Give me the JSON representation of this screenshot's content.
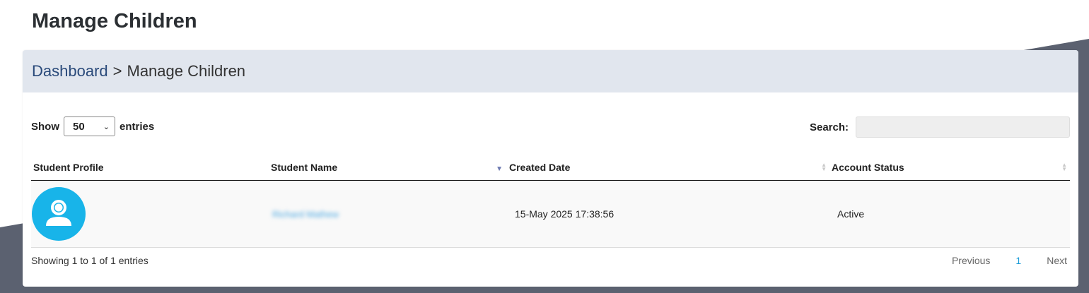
{
  "page_title": "Manage Children",
  "breadcrumb": {
    "link": "Dashboard",
    "separator": ">",
    "current": "Manage Children"
  },
  "length_control": {
    "prefix": "Show",
    "value": "50",
    "suffix": "entries"
  },
  "search": {
    "label": "Search:",
    "value": "",
    "placeholder": ""
  },
  "table": {
    "headers": [
      "Student Profile",
      "Student Name",
      "Created Date",
      "Account Status"
    ],
    "sorted_column": "Created Date",
    "rows": [
      {
        "avatar_icon": "user-avatar-icon",
        "name": "Richard Mathew",
        "created": "15-May 2025 17:38:56",
        "status": "Active"
      }
    ]
  },
  "footer": {
    "info": "Showing 1 to 1 of 1 entries",
    "previous": "Previous",
    "page": "1",
    "next": "Next"
  },
  "colors": {
    "accent": "#18b4e9",
    "header_bg": "#e1e6ee",
    "dark_bg": "#5b6170",
    "link": "#2a4a7a"
  }
}
